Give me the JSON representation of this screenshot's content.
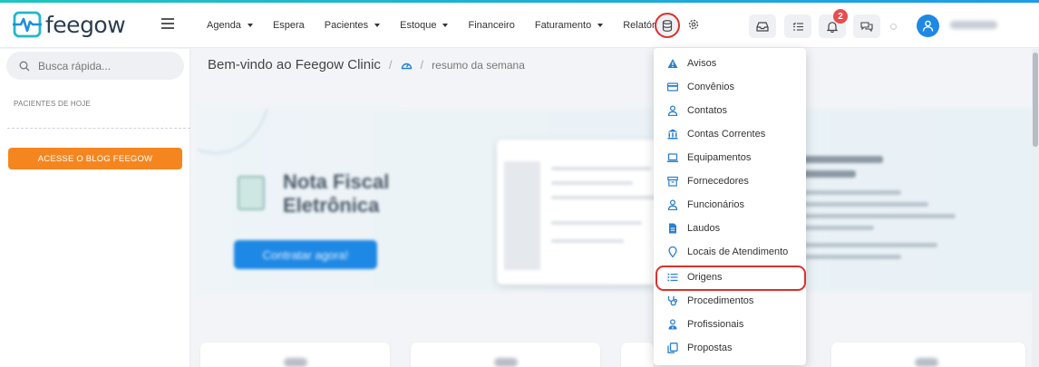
{
  "brand": {
    "name": "feegow"
  },
  "nav": {
    "items": [
      {
        "label": "Agenda",
        "has_caret": true
      },
      {
        "label": "Espera",
        "has_caret": false
      },
      {
        "label": "Pacientes",
        "has_caret": true
      },
      {
        "label": "Estoque",
        "has_caret": true
      },
      {
        "label": "Financeiro",
        "has_caret": false
      },
      {
        "label": "Faturamento",
        "has_caret": true
      },
      {
        "label": "Relatórios",
        "has_caret": false
      }
    ]
  },
  "header": {
    "notifications_count": "2",
    "icons": [
      "database-icon",
      "gear-icon",
      "inbox-icon",
      "checklist-icon",
      "bell-icon",
      "chat-icon",
      "user-icon"
    ]
  },
  "sidebar": {
    "search_placeholder": "Busca rápida...",
    "section_title": "PACIENTES DE HOJE",
    "blog_button": "ACESSE O BLOG FEEGOW"
  },
  "breadcrumb": {
    "title": "Bem-vindo ao Feegow Clinic",
    "separator": "/",
    "current": "resumo da semana"
  },
  "banner": {
    "title_line1": "Nota Fiscal",
    "title_line2": "Eletrônica",
    "button": "Contratar agora!"
  },
  "dropdown": {
    "items": [
      {
        "label": "Avisos",
        "icon": "warning-icon"
      },
      {
        "label": "Convênios",
        "icon": "card-icon"
      },
      {
        "label": "Contatos",
        "icon": "person-icon"
      },
      {
        "label": "Contas Correntes",
        "icon": "bank-icon"
      },
      {
        "label": "Equipamentos",
        "icon": "laptop-icon"
      },
      {
        "label": "Fornecedores",
        "icon": "box-icon"
      },
      {
        "label": "Funcionários",
        "icon": "person-icon"
      },
      {
        "label": "Laudos",
        "icon": "document-icon"
      },
      {
        "label": "Locais de Atendimento",
        "icon": "location-icon"
      },
      {
        "label": "Origens",
        "icon": "list-icon"
      },
      {
        "label": "Procedimentos",
        "icon": "stethoscope-icon"
      },
      {
        "label": "Profissionais",
        "icon": "doctor-icon"
      },
      {
        "label": "Propostas",
        "icon": "copy-icon"
      }
    ],
    "highlighted_item": "Origens"
  },
  "colors": {
    "accent_blue": "#1e88e5",
    "orange": "#f5861f",
    "highlight_red": "#d9312b",
    "badge_red": "#e84c4c"
  }
}
